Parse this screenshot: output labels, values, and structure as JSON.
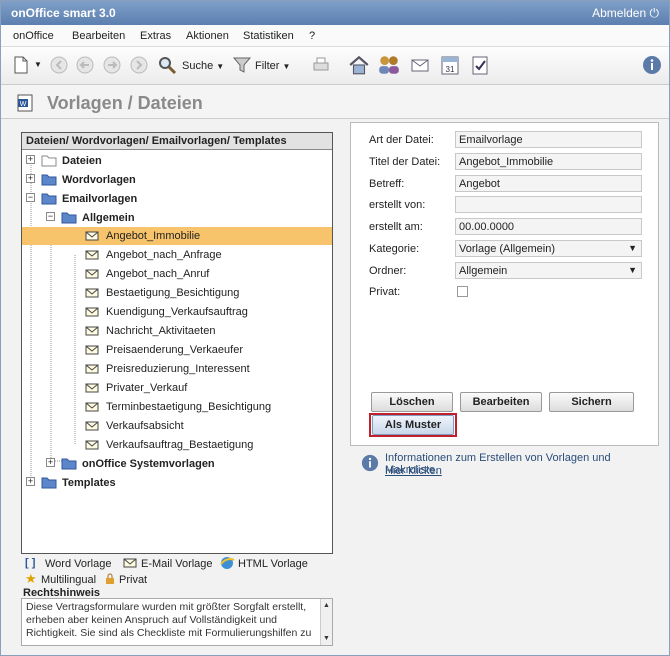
{
  "app": {
    "title": "onOffice smart 3.0",
    "logout": "Abmelden"
  },
  "menu": [
    "onOffice",
    "Bearbeiten",
    "Extras",
    "Aktionen",
    "Statistiken",
    "?"
  ],
  "toolbar": {
    "search": "Suche",
    "filter": "Filter"
  },
  "page": {
    "title": "Vorlagen / Dateien"
  },
  "tree": {
    "header": "Dateien/ Wordvorlagen/ Emailvorlagen/ Templates",
    "folders": {
      "dateien": "Dateien",
      "word": "Wordvorlagen",
      "email": "Emailvorlagen",
      "allgemein": "Allgemein",
      "system": "onOffice Systemvorlagen",
      "templates": "Templates"
    },
    "items": [
      "Angebot_Immobilie",
      "Angebot_nach_Anfrage",
      "Angebot_nach_Anruf",
      "Bestaetigung_Besichtigung",
      "Kuendigung_Verkaufsauftrag",
      "Nachricht_Aktivitaeten",
      "Preisaenderung_Verkaeufer",
      "Preisreduzierung_Interessent",
      "Privater_Verkauf",
      "Terminbestaetigung_Besichtigung",
      "Verkaufsabsicht",
      "Verkaufsauftrag_Bestaetigung"
    ],
    "selected": "Angebot_Immobilie"
  },
  "legend": {
    "word": "Word Vorlage",
    "email": "E-Mail Vorlage",
    "html": "HTML Vorlage",
    "multi": "Multilingual",
    "privat": "Privat"
  },
  "rechtshinweis": {
    "title": "Rechtshinweis",
    "text": "Diese Vertragsformulare wurden mit größter Sorgfalt erstellt, erheben aber keinen Anspruch auf Vollständigkeit und Richtigkeit. Sie sind als Checkliste mit Formulierungshilfen zu"
  },
  "form": {
    "art_label": "Art der Datei:",
    "art": "Emailvorlage",
    "titel_label": "Titel der Datei:",
    "titel": "Angebot_Immobilie",
    "betreff_label": "Betreff:",
    "betreff": "Angebot",
    "erstellt_von_label": "erstellt von:",
    "erstellt_von": "",
    "erstellt_am_label": "erstellt am:",
    "erstellt_am": "00.00.0000",
    "kategorie_label": "Kategorie:",
    "kategorie": "Vorlage (Allgemein)",
    "ordner_label": "Ordner:",
    "ordner": "Allgemein",
    "privat_label": "Privat:"
  },
  "buttons": {
    "loeschen": "Löschen",
    "bearbeiten": "Bearbeiten",
    "sichern": "Sichern",
    "muster": "Als Muster"
  },
  "info": {
    "text": "Informationen zum Erstellen von Vorlagen und Makroliste.",
    "link": "Hier klicken"
  }
}
